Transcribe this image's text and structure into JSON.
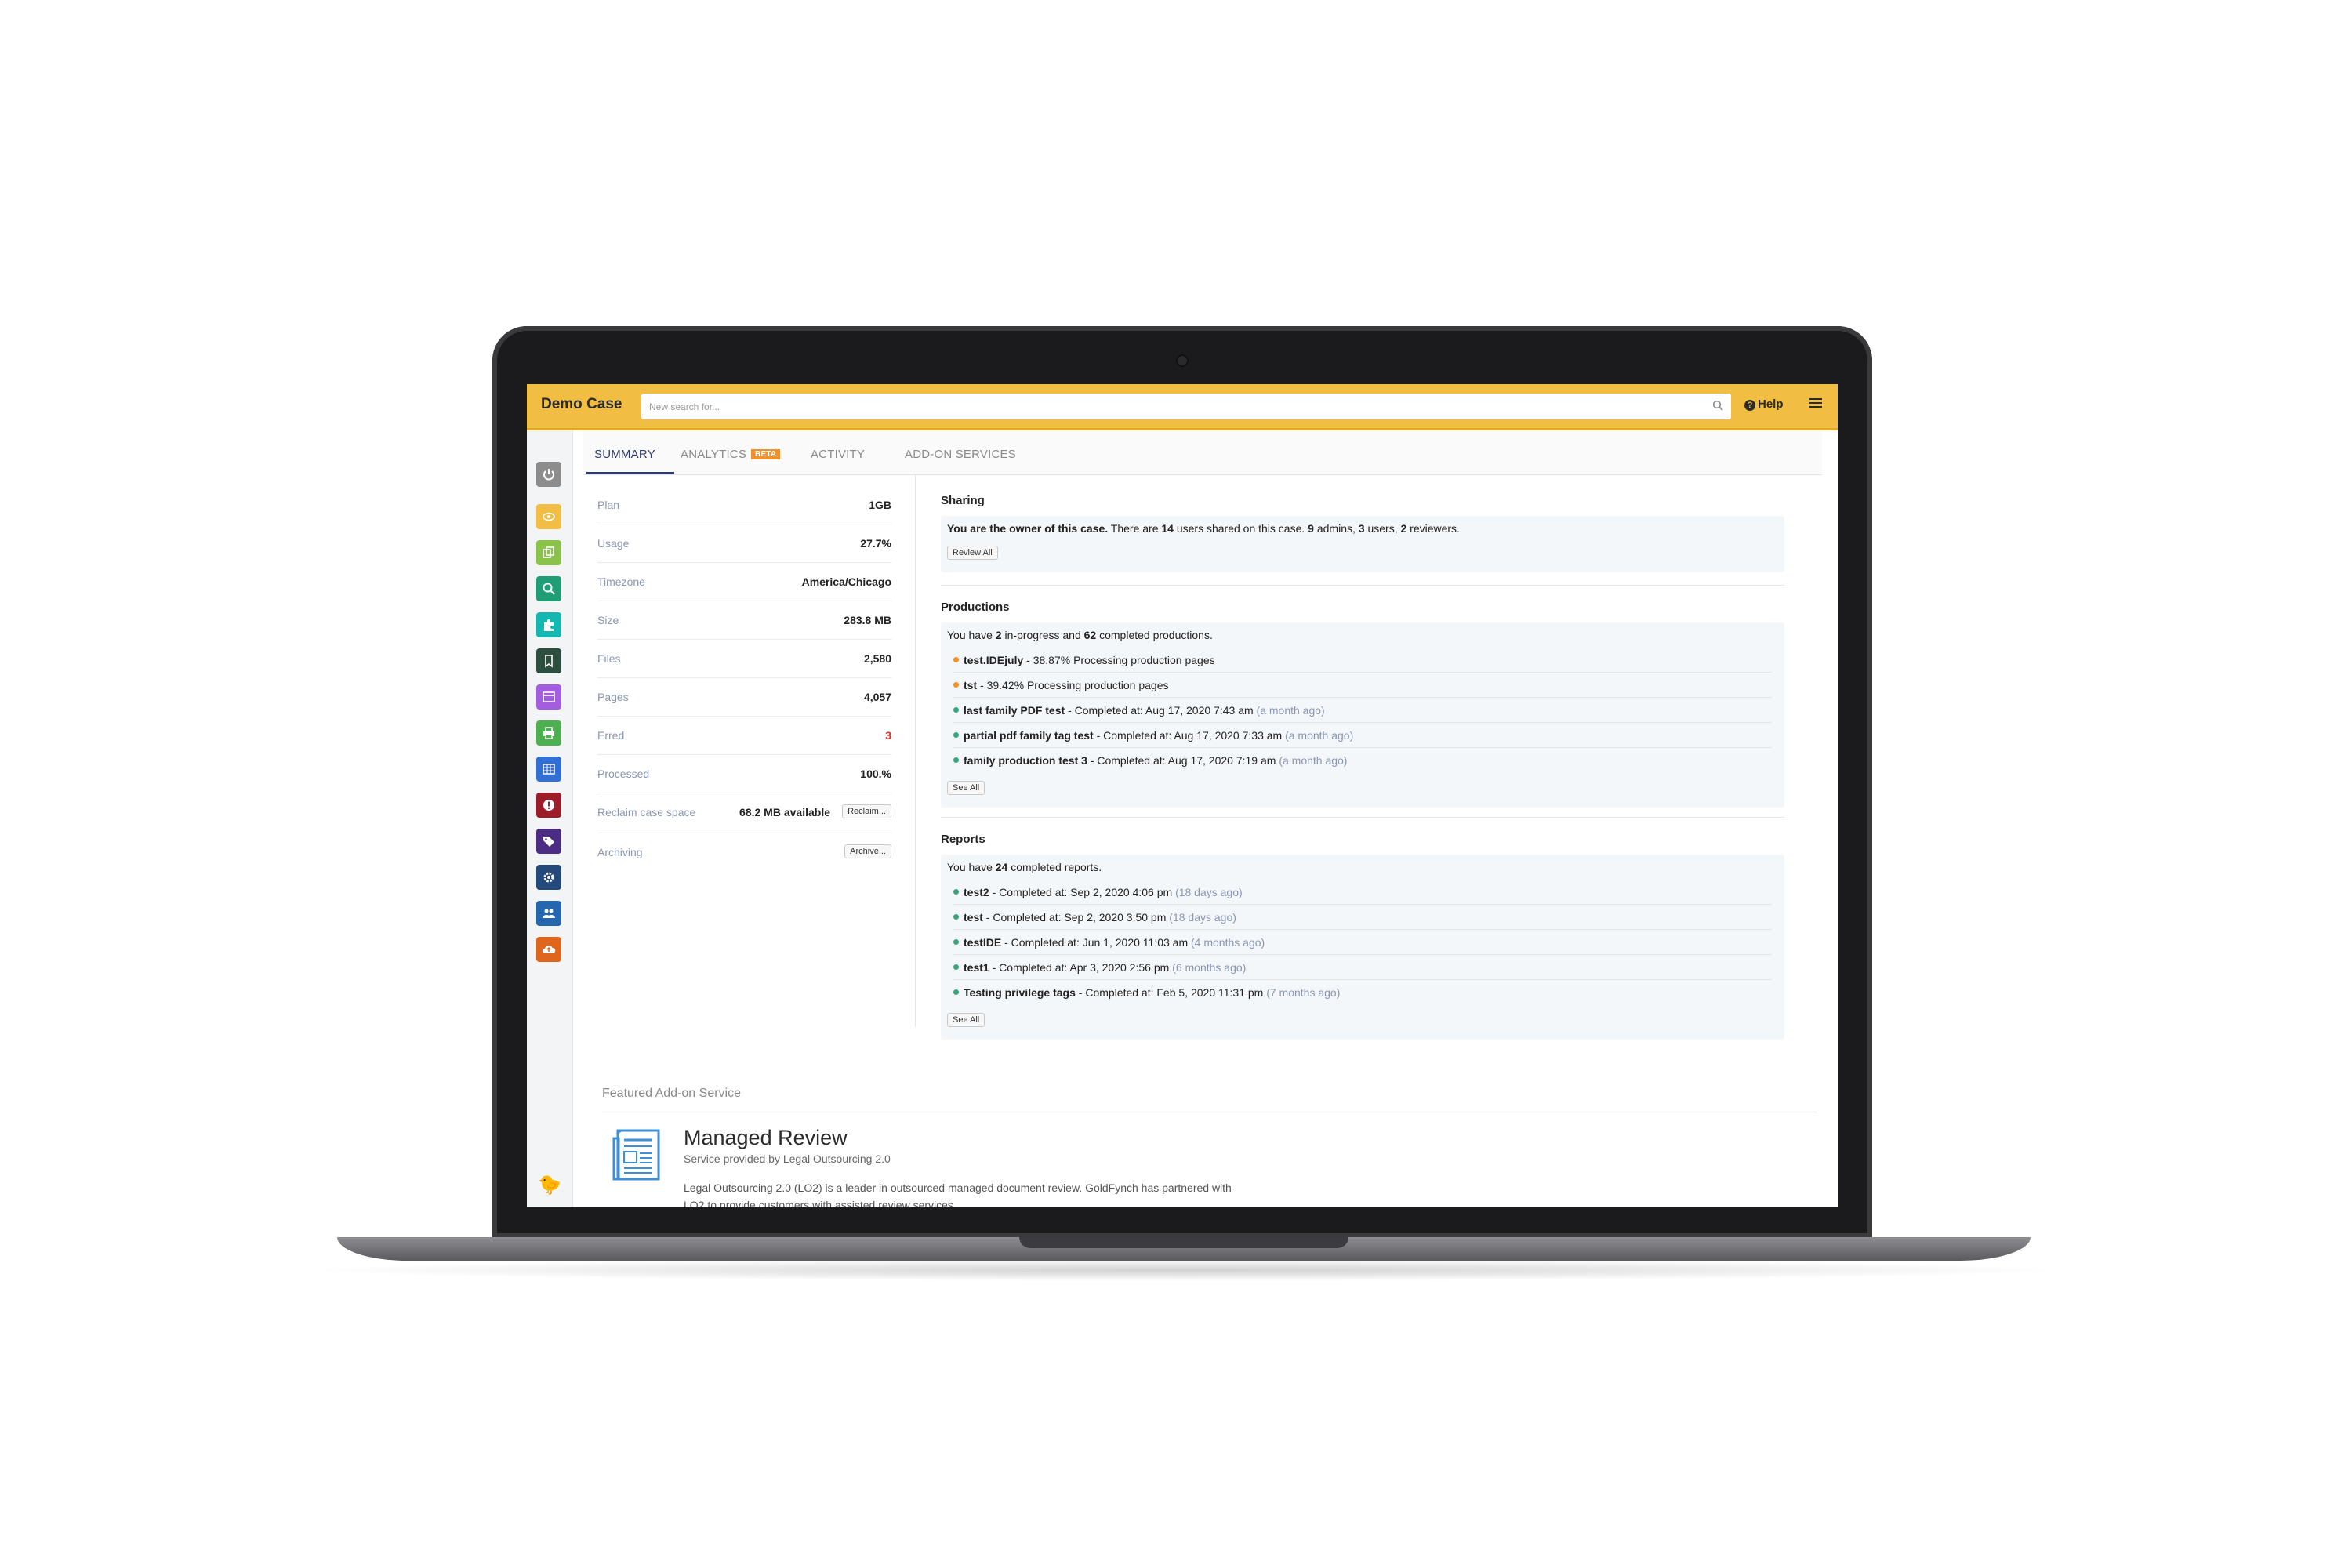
{
  "app": {
    "case_name": "Demo Case",
    "search_placeholder": "New search for...",
    "help_label": "Help"
  },
  "tabs": [
    {
      "label": "SUMMARY",
      "active": true
    },
    {
      "label": "ANALYTICS",
      "badge": "BETA"
    },
    {
      "label": "ACTIVITY"
    },
    {
      "label": "ADD-ON SERVICES"
    }
  ],
  "sidebar": {
    "icons": [
      {
        "name": "power-icon",
        "color": "#8c8c8c"
      },
      {
        "name": "eye-icon",
        "color": "#f1bd42"
      },
      {
        "name": "copy-icon",
        "color": "#8bc34a"
      },
      {
        "name": "search-icon",
        "color": "#1f9d74"
      },
      {
        "name": "puzzle-icon",
        "color": "#14b8b0"
      },
      {
        "name": "bookmark-icon",
        "color": "#2d4f3f"
      },
      {
        "name": "calendar-icon",
        "color": "#a45de0"
      },
      {
        "name": "print-icon",
        "color": "#4caf50"
      },
      {
        "name": "table-icon",
        "color": "#2f6fd6"
      },
      {
        "name": "alert-icon",
        "color": "#9b1d2a"
      },
      {
        "name": "tags-icon",
        "color": "#4b2e83"
      },
      {
        "name": "gear-icon",
        "color": "#234a7a"
      },
      {
        "name": "users-icon",
        "color": "#2566b0"
      },
      {
        "name": "cloud-upload-icon",
        "color": "#e0661d"
      }
    ]
  },
  "stats": {
    "rows": [
      {
        "label": "Plan",
        "value": "1GB"
      },
      {
        "label": "Usage",
        "value": "27.7%"
      },
      {
        "label": "Timezone",
        "value": "America/Chicago"
      },
      {
        "label": "Size",
        "value": "283.8 MB"
      },
      {
        "label": "Files",
        "value": "2,580"
      },
      {
        "label": "Pages",
        "value": "4,057"
      },
      {
        "label": "Erred",
        "value": "3"
      },
      {
        "label": "Processed",
        "value": "100.%"
      }
    ],
    "reclaim": {
      "label": "Reclaim case space",
      "available": "68.2 MB available",
      "button": "Reclaim..."
    },
    "archiving": {
      "label": "Archiving",
      "button": "Archive..."
    }
  },
  "sharing": {
    "title": "Sharing",
    "owner_text": "You are the owner of this case.",
    "text_a": "There are",
    "users_shared": "14",
    "text_b": "users shared on this case.",
    "admins": "9",
    "text_c": "admins,",
    "users": "3",
    "text_d": "users,",
    "reviewers": "2",
    "text_e": "reviewers.",
    "button": "Review All"
  },
  "productions": {
    "title": "Productions",
    "text_a": "You have",
    "in_progress": "2",
    "text_b": "in-progress and",
    "completed": "62",
    "text_c": "completed productions.",
    "items": [
      {
        "name": "test.IDEjuly",
        "detail": "- 38.87% Processing production pages",
        "ago": "",
        "status": "in-progress"
      },
      {
        "name": "tst",
        "detail": "- 39.42% Processing production pages",
        "ago": "",
        "status": "in-progress"
      },
      {
        "name": "last family PDF test",
        "detail": "- Completed at: Aug 17, 2020 7:43 am",
        "ago": "(a month ago)",
        "status": "completed"
      },
      {
        "name": "partial pdf family tag test",
        "detail": "- Completed at: Aug 17, 2020 7:33 am",
        "ago": "(a month ago)",
        "status": "completed"
      },
      {
        "name": "family production test 3",
        "detail": "- Completed at: Aug 17, 2020 7:19 am",
        "ago": "(a month ago)",
        "status": "completed"
      }
    ],
    "button": "See All"
  },
  "reports": {
    "title": "Reports",
    "text_a": "You have",
    "completed": "24",
    "text_b": "completed reports.",
    "items": [
      {
        "name": "test2",
        "detail": "- Completed at: Sep 2, 2020 4:06 pm",
        "ago": "(18 days ago)"
      },
      {
        "name": "test",
        "detail": "- Completed at: Sep 2, 2020 3:50 pm",
        "ago": "(18 days ago)"
      },
      {
        "name": "testIDE",
        "detail": "- Completed at: Jun 1, 2020 11:03 am",
        "ago": "(4 months ago)"
      },
      {
        "name": "test1",
        "detail": "- Completed at: Apr 3, 2020 2:56 pm",
        "ago": "(6 months ago)"
      },
      {
        "name": "Testing privilege tags",
        "detail": "- Completed at: Feb 5, 2020 11:31 pm",
        "ago": "(7 months ago)"
      }
    ],
    "button": "See All"
  },
  "featured": {
    "section_label": "Featured Add-on Service",
    "title": "Managed Review",
    "subtitle": "Service provided by Legal Outsourcing 2.0",
    "description": "Legal Outsourcing 2.0 (LO2) is a leader in outsourced managed document review. GoldFynch has partnered with LO2 to provide customers with assisted review services."
  },
  "colors": {
    "topbar": "#f1bd42",
    "active_tab": "#2e3a6e",
    "in_progress_dot": "#f0912a",
    "completed_dot": "#3aa57a",
    "error": "#d9342b"
  }
}
